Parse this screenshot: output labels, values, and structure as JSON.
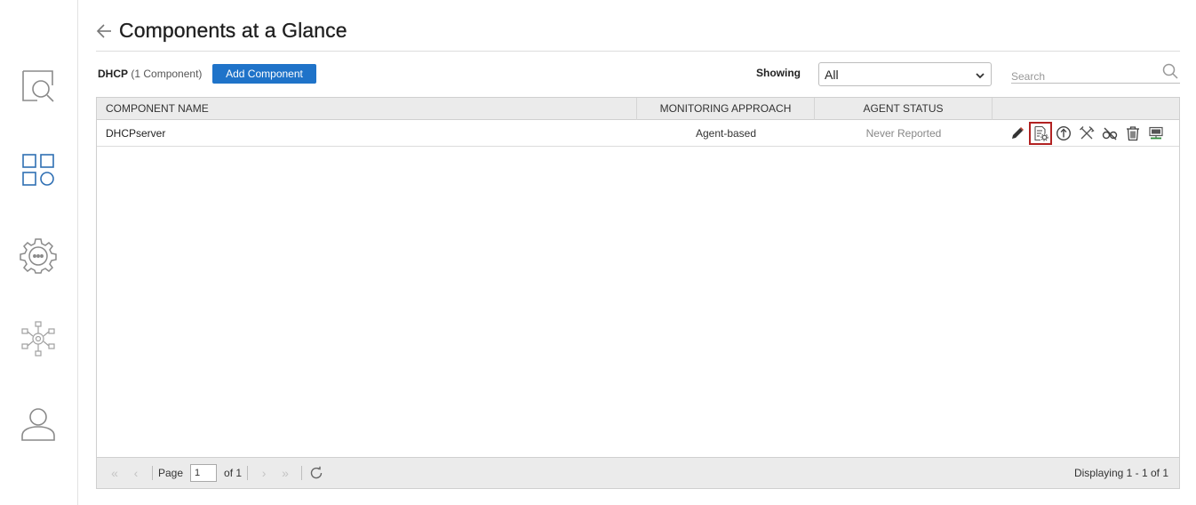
{
  "sidebar": {
    "items": [
      {
        "icon": "monitor-search-icon"
      },
      {
        "icon": "components-grid-icon",
        "active": true
      },
      {
        "icon": "settings-gear-icon"
      },
      {
        "icon": "network-config-icon"
      },
      {
        "icon": "user-profile-icon"
      }
    ]
  },
  "header": {
    "title": "Components at a Glance"
  },
  "toolbar": {
    "group_name": "DHCP",
    "group_count": "(1 Component)",
    "add_label": "Add Component",
    "showing_label": "Showing",
    "showing_value": "All",
    "search_placeholder": "Search"
  },
  "grid": {
    "columns": [
      "COMPONENT NAME",
      "MONITORING APPROACH",
      "AGENT STATUS",
      ""
    ],
    "rows": [
      {
        "name": "DHCPserver",
        "approach": "Agent-based",
        "status": "Never Reported",
        "actions": [
          "edit-icon",
          "config-settings-icon",
          "priority-icon",
          "tools-icon",
          "unmonitor-icon",
          "delete-icon",
          "ip-address-icon"
        ],
        "selected_action": "config-settings-icon"
      }
    ]
  },
  "pager": {
    "page_label": "Page",
    "page_value": "1",
    "of_label": "of 1",
    "displaying": "Displaying 1 - 1 of 1"
  },
  "colors": {
    "accent": "#1f73c9",
    "sidebar_active": "#2f6fb3",
    "selected_border": "#b22222"
  }
}
